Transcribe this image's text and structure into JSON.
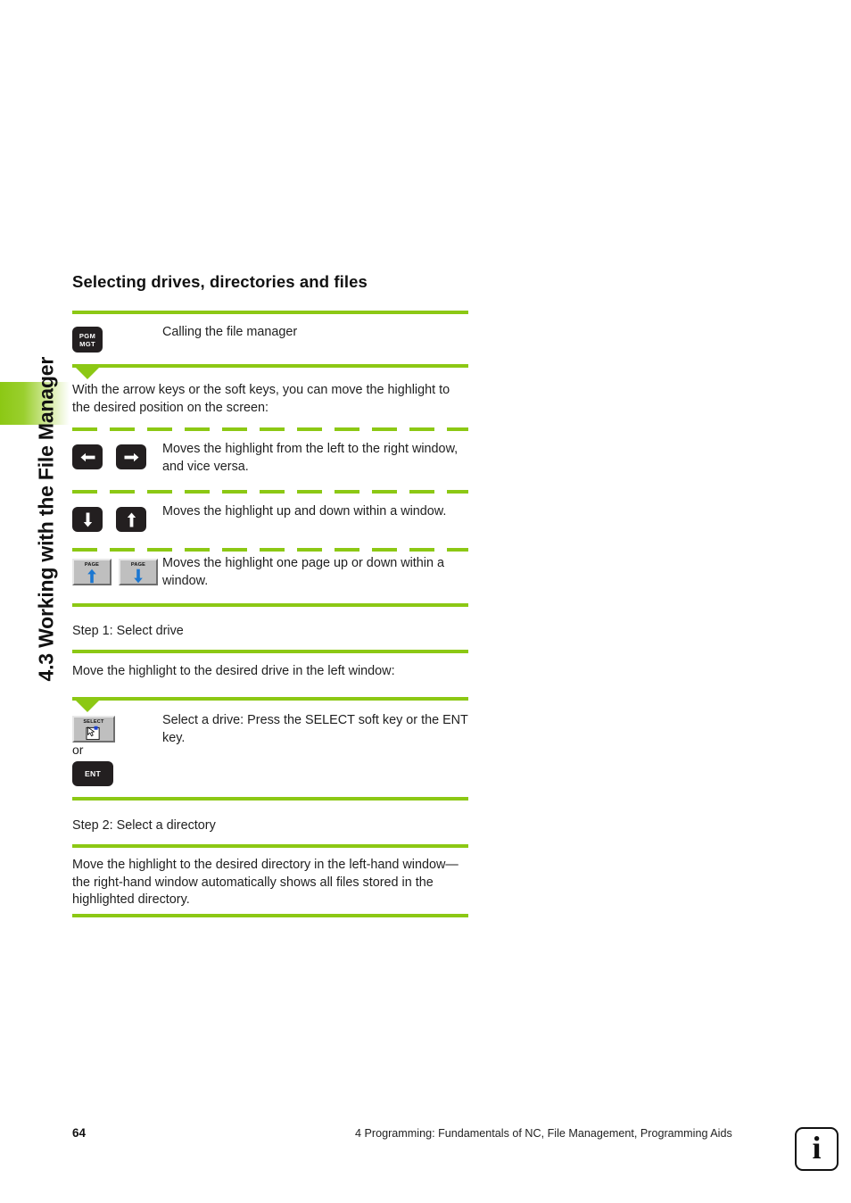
{
  "sidebar": {
    "running_head": "4.3 Working with the File Manager",
    "highlight_color": "#8CC814"
  },
  "accent_color": "#8CC814",
  "page": {
    "heading": "Selecting drives, directories and files"
  },
  "blocks": {
    "pgm_mgt_key": {
      "line1": "PGM",
      "line2": "MGT"
    },
    "pgm_mgt_desc": "Calling the file manager",
    "intro_para": "With the arrow keys or the soft keys, you can move the highlight to the desired position on the screen:",
    "left_right_desc": "Moves the highlight from the left to the right window, and vice versa.",
    "up_down_desc": "Moves the highlight up and down within a window.",
    "page_keys_desc": "Moves the highlight one page up or down within a window.",
    "page_key_label": "PAGE",
    "step1_title": "Step 1: Select drive",
    "step1_para": "Move the highlight to the desired drive in the left window:",
    "select_key_label": "SELECT",
    "select_desc": "Select a drive: Press the SELECT soft key or the ENT key.",
    "or_label": "or",
    "ent_key_label": "ENT",
    "step2_title": "Step 2: Select a directory",
    "step2_para": "Move the highlight to the desired directory in the left-hand window—the right-hand window automatically shows all files stored in the highlighted directory."
  },
  "footer": {
    "page_number": "64",
    "title": "4 Programming: Fundamentals of NC, File Management, Programming Aids",
    "info_glyph": "i"
  }
}
